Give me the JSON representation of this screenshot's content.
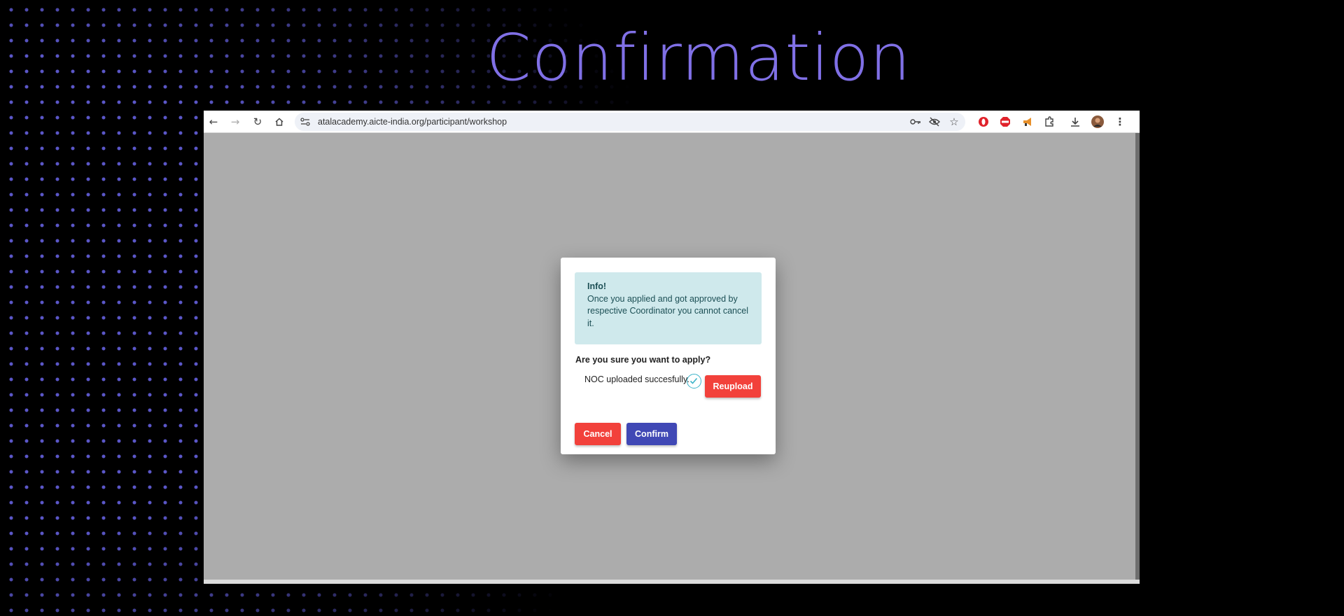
{
  "slide": {
    "title": "Confirmation"
  },
  "browser": {
    "url": "atalacademy.aicte-india.org/participant/workshop",
    "toolbar_icons": [
      "back-arrow-icon",
      "forward-arrow-icon",
      "reload-icon",
      "home-icon",
      "site-info-icon",
      "password-key-icon",
      "eye-off-icon",
      "star-icon",
      "opera-extension-icon",
      "adblock-icon",
      "megaphone-extension-icon",
      "extensions-puzzle-icon",
      "download-icon",
      "profile-avatar",
      "more-menu-icon"
    ]
  },
  "modal": {
    "info_title": "Info!",
    "info_text": "Once you applied and got approved by respective Coordinator you cannot cancel it.",
    "question": "Are you sure you want to apply?",
    "noc_status": "NOC uploaded succesfully.",
    "reupload_label": "Reupload",
    "cancel_label": "Cancel",
    "confirm_label": "Confirm"
  },
  "colors": {
    "title": "#8070e6",
    "danger": "#f2413b",
    "primary": "#4048b5",
    "info_bg": "#cfe9ec",
    "overlay": "#acacac"
  }
}
